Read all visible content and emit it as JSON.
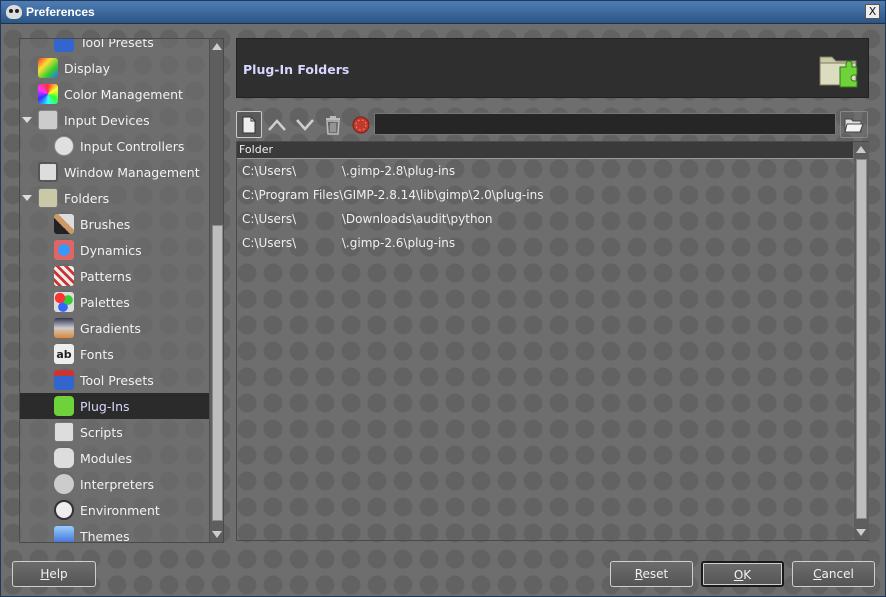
{
  "window": {
    "title": "Preferences",
    "close_glyph": "X"
  },
  "sidebar": {
    "items": [
      {
        "label": "Tool Presets",
        "icon": "tool-presets-icon",
        "level": 1,
        "partial": true
      },
      {
        "label": "Display",
        "icon": "display-icon",
        "level": 0
      },
      {
        "label": "Color Management",
        "icon": "color-management-icon",
        "level": 0
      },
      {
        "label": "Input Devices",
        "icon": "input-devices-icon",
        "level": 0,
        "expanded": true
      },
      {
        "label": "Input Controllers",
        "icon": "input-controllers-icon",
        "level": 1
      },
      {
        "label": "Window Management",
        "icon": "window-management-icon",
        "level": 0
      },
      {
        "label": "Folders",
        "icon": "folders-icon",
        "level": 0,
        "expanded": true
      },
      {
        "label": "Brushes",
        "icon": "brushes-icon",
        "level": 1
      },
      {
        "label": "Dynamics",
        "icon": "dynamics-icon",
        "level": 1
      },
      {
        "label": "Patterns",
        "icon": "patterns-icon",
        "level": 1
      },
      {
        "label": "Palettes",
        "icon": "palettes-icon",
        "level": 1
      },
      {
        "label": "Gradients",
        "icon": "gradients-icon",
        "level": 1
      },
      {
        "label": "Fonts",
        "icon": "fonts-icon",
        "level": 1
      },
      {
        "label": "Tool Presets",
        "icon": "tool-presets-icon",
        "level": 1
      },
      {
        "label": "Plug-Ins",
        "icon": "plug-ins-icon",
        "level": 1,
        "selected": true
      },
      {
        "label": "Scripts",
        "icon": "scripts-icon",
        "level": 1
      },
      {
        "label": "Modules",
        "icon": "modules-icon",
        "level": 1
      },
      {
        "label": "Interpreters",
        "icon": "interpreters-icon",
        "level": 1
      },
      {
        "label": "Environment",
        "icon": "environment-icon",
        "level": 1
      },
      {
        "label": "Themes",
        "icon": "themes-icon",
        "level": 1
      }
    ]
  },
  "header": {
    "title": "Plug-In Folders",
    "icon": "plug-in-folder-icon"
  },
  "toolbar": {
    "new_icon": "new-document-icon",
    "up_icon": "move-up-icon",
    "down_icon": "move-down-icon",
    "delete_icon": "trash-icon",
    "status_icon": "invalid-path-icon",
    "path_value": "",
    "browse_icon": "browse-folder-icon"
  },
  "folder_list": {
    "column_header": "Folder",
    "rows": [
      "C:\\Users\\            \\.gimp-2.8\\plug-ins",
      "C:\\Program Files\\GIMP-2.8.14\\lib\\gimp\\2.0\\plug-ins",
      "C:\\Users\\            \\Downloads\\audit\\python",
      "C:\\Users\\            \\.gimp-2.6\\plug-ins"
    ]
  },
  "buttons": {
    "help": {
      "mnemonic": "H",
      "rest": "elp"
    },
    "reset": {
      "mnemonic": "R",
      "rest": "eset"
    },
    "ok": {
      "mnemonic": "O",
      "rest": "K"
    },
    "cancel": {
      "mnemonic": "C",
      "rest": "ancel"
    }
  },
  "colors": {
    "selected_bg": "#2b2b2b",
    "header_text": "#d6d6ff",
    "titlebar": "#2c5585"
  }
}
